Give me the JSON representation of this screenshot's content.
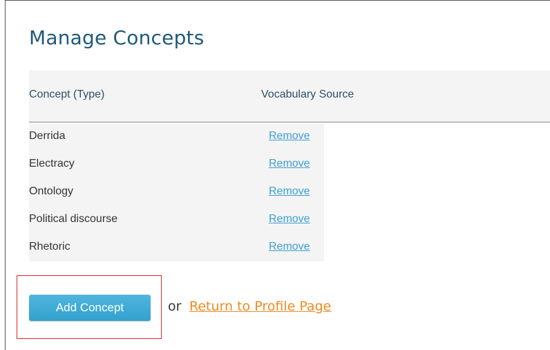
{
  "page": {
    "title": "Manage Concepts"
  },
  "table": {
    "headers": {
      "concept": "Concept (Type)",
      "vocabulary": "Vocabulary Source"
    },
    "rows": [
      {
        "concept": "Derrida",
        "action": "Remove"
      },
      {
        "concept": "Electracy",
        "action": "Remove"
      },
      {
        "concept": "Ontology",
        "action": "Remove"
      },
      {
        "concept": "Political discourse",
        "action": "Remove"
      },
      {
        "concept": "Rhetoric",
        "action": "Remove"
      }
    ]
  },
  "actions": {
    "add_label": "Add Concept",
    "or_text": "or",
    "return_label": "Return to Profile Page"
  },
  "colors": {
    "title": "#1f5a78",
    "link_blue": "#3b9ed6",
    "link_orange": "#ef8a1f",
    "button": "#3aa8d2",
    "highlight": "#d9272e"
  }
}
